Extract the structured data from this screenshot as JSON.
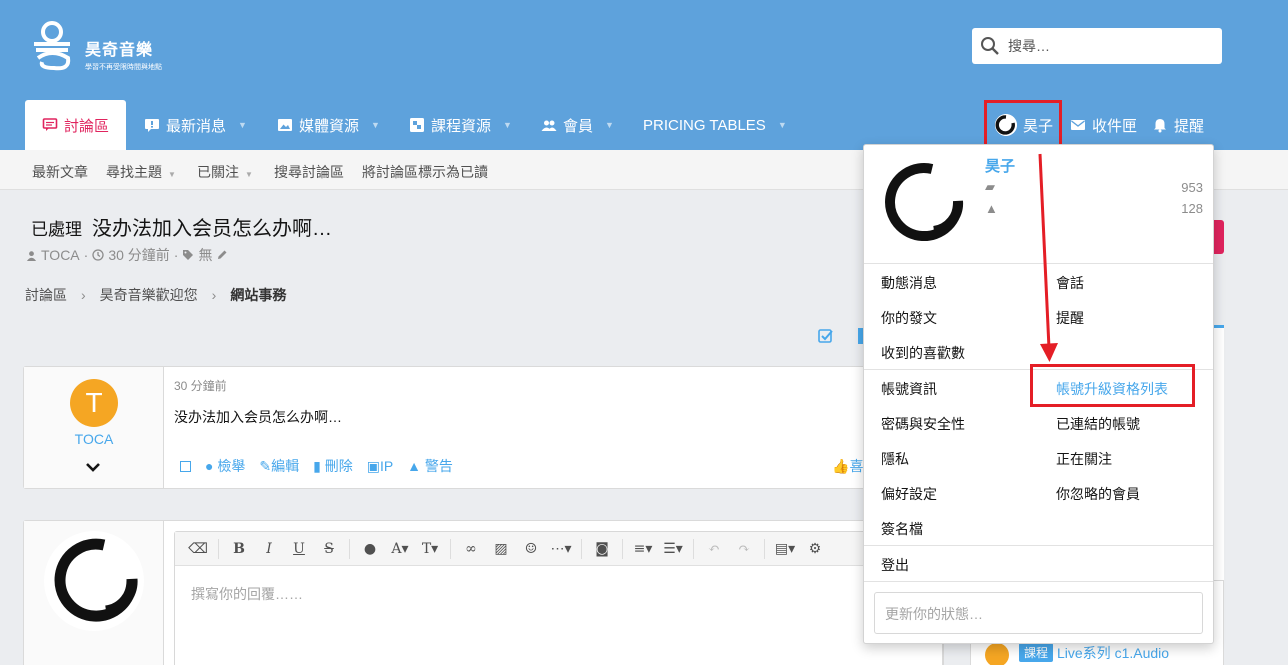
{
  "brand": {
    "name": "昊奇音樂",
    "tagline": "學習不再受限時間與地點"
  },
  "search": {
    "placeholder": "搜尋…"
  },
  "nav": {
    "items": [
      {
        "label": "討論區",
        "icon": "forum-icon",
        "active": true
      },
      {
        "label": "最新消息",
        "icon": "news-icon"
      },
      {
        "label": "媒體資源",
        "icon": "image-icon"
      },
      {
        "label": "課程資源",
        "icon": "course-icon"
      },
      {
        "label": "會員",
        "icon": "members-icon"
      },
      {
        "label": "PRICING TABLES",
        "icon": ""
      }
    ],
    "user": "昊子",
    "inbox": "收件匣",
    "alerts": "提醒"
  },
  "subnav": {
    "items": [
      "最新文章",
      "尋找主題",
      "已關注",
      "搜尋討論區",
      "將討論區標示為已讀"
    ]
  },
  "thread": {
    "prefix": "已處理",
    "title": "没办法加入会员怎么办啊…",
    "author": "TOCA",
    "time": "30 分鐘前",
    "tags": "無"
  },
  "breadcrumbs": [
    "討論區",
    "昊奇音樂歡迎您",
    "網站事務"
  ],
  "post": {
    "username": "TOCA",
    "avatar_letter": "T",
    "time": "30 分鐘前",
    "body": "没办法加入会员怎么办啊…",
    "actions": [
      "檢舉",
      "編輯",
      "刪除",
      "IP",
      "警告"
    ],
    "like": "喜"
  },
  "reply": {
    "placeholder": "撰寫你的回覆……",
    "toolbar": [
      "B",
      "I",
      "U",
      "S",
      "A",
      "T"
    ]
  },
  "account_menu": {
    "username": "昊子",
    "messages": "953",
    "likes": "128",
    "col_left": [
      "動態消息",
      "你的發文",
      "收到的喜歡數"
    ],
    "col_right": [
      "會話",
      "提醒"
    ],
    "settings_left": [
      "帳號資訊",
      "密碼與安全性",
      "隱私",
      "偏好設定",
      "簽名檔"
    ],
    "settings_right": [
      "帳號升級資格列表",
      "已連結的帳號",
      "正在關注",
      "你忽略的會員"
    ],
    "logout": "登出",
    "status_placeholder": "更新你的狀態…"
  },
  "sidebar": {
    "badge": "課程",
    "item": "Live系列 c1.Audio"
  },
  "colors": {
    "header": "#5ea2dc",
    "accent": "#e0245e",
    "link": "#47a7eb",
    "highlight": "#e41e26"
  }
}
